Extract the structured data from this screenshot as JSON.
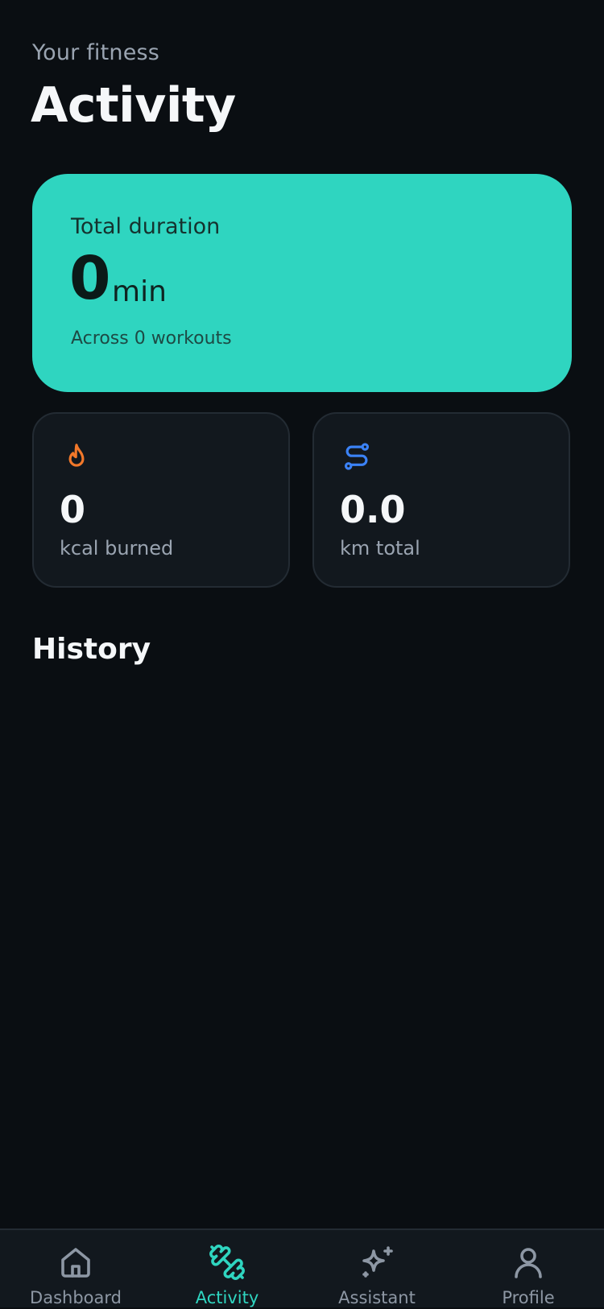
{
  "header": {
    "subtitle": "Your fitness",
    "title": "Activity"
  },
  "summary": {
    "label": "Total duration",
    "value": "0",
    "unit": "min",
    "note": "Across 0 workouts",
    "accent_color": "#2fd5c0"
  },
  "stats": [
    {
      "icon": "flame-icon",
      "value": "0",
      "label": "kcal burned",
      "color": "#f2782a"
    },
    {
      "icon": "route-icon",
      "value": "0.0",
      "label": "km total",
      "color": "#3b82f6"
    }
  ],
  "history": {
    "title": "History"
  },
  "nav": {
    "items": [
      {
        "icon": "home-icon",
        "label": "Dashboard",
        "active": false
      },
      {
        "icon": "dumbbell-icon",
        "label": "Activity",
        "active": true
      },
      {
        "icon": "sparkle-icon",
        "label": "Assistant",
        "active": false
      },
      {
        "icon": "user-icon",
        "label": "Profile",
        "active": false
      }
    ]
  }
}
